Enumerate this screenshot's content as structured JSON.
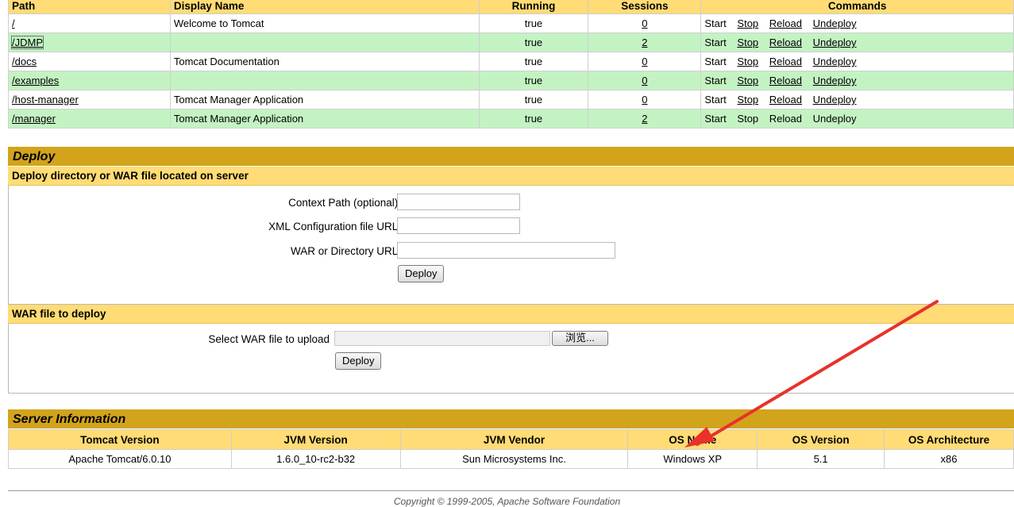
{
  "apps_table": {
    "headers": {
      "path": "Path",
      "display_name": "Display Name",
      "running": "Running",
      "sessions": "Sessions",
      "commands": "Commands"
    },
    "rows": [
      {
        "path": "/",
        "display_name": "Welcome to Tomcat",
        "running": "true",
        "sessions": "0"
      },
      {
        "path": "/JDMP",
        "display_name": "",
        "running": "true",
        "sessions": "2"
      },
      {
        "path": "/docs",
        "display_name": "Tomcat Documentation",
        "running": "true",
        "sessions": "0"
      },
      {
        "path": "/examples",
        "display_name": "",
        "running": "true",
        "sessions": "0"
      },
      {
        "path": "/host-manager",
        "display_name": "Tomcat Manager Application",
        "running": "true",
        "sessions": "0"
      },
      {
        "path": "/manager",
        "display_name": "Tomcat Manager Application",
        "running": "true",
        "sessions": "2"
      }
    ],
    "commands": {
      "start": "Start",
      "stop": "Stop",
      "reload": "Reload",
      "undeploy": "Undeploy"
    }
  },
  "deploy": {
    "title": "Deploy",
    "server_section": {
      "title": "Deploy directory or WAR file located on server",
      "context_path_label": "Context Path (optional):",
      "context_path_value": "",
      "xml_config_label": "XML Configuration file URL:",
      "xml_config_value": "",
      "war_dir_label": "WAR or Directory URL:",
      "war_dir_value": "",
      "button": "Deploy"
    },
    "war_section": {
      "title": "WAR file to deploy",
      "select_label": "Select WAR file to upload",
      "browse_button": "浏览...",
      "button": "Deploy"
    }
  },
  "server_info": {
    "title": "Server Information",
    "headers": [
      "Tomcat Version",
      "JVM Version",
      "JVM Vendor",
      "OS Name",
      "OS Version",
      "OS Architecture"
    ],
    "values": [
      "Apache Tomcat/6.0.10",
      "1.6.0_10-rc2-b32",
      "Sun Microsystems Inc.",
      "Windows XP",
      "5.1",
      "x86"
    ]
  },
  "footer": {
    "text": "Copyright © 1999-2005, Apache Software Foundation"
  },
  "colors": {
    "header": "#FFDC75",
    "section": "#D2A41C",
    "row_alt": "#C3F3C3",
    "annotation_arrow": "#E8322A"
  }
}
